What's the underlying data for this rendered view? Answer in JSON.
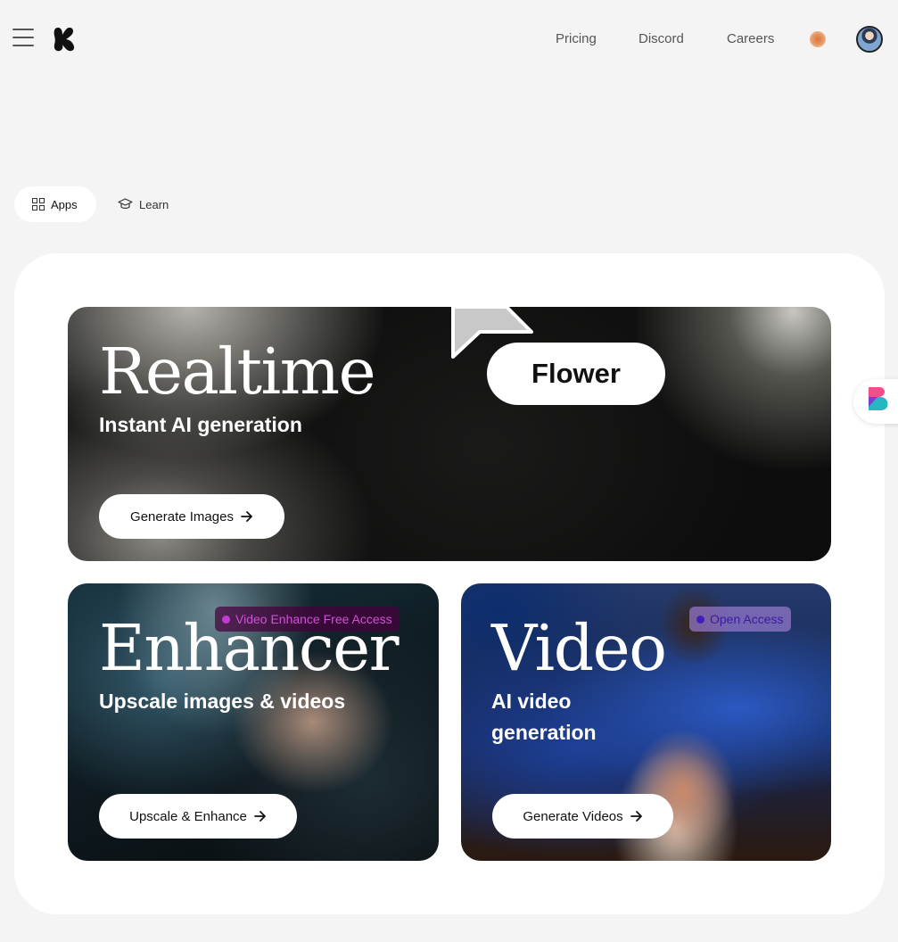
{
  "header": {
    "nav": [
      "Pricing",
      "Discord",
      "Careers"
    ]
  },
  "tabs": [
    {
      "label": "Apps",
      "active": true,
      "icon": "grid-icon"
    },
    {
      "label": "Learn",
      "active": false,
      "icon": "graduation-cap-icon"
    }
  ],
  "cards": {
    "realtime": {
      "title": "Realtime",
      "subtitle": "Instant AI generation",
      "cta": "Generate Images",
      "demo_prompt": "Flower"
    },
    "enhancer": {
      "title": "Enhancer",
      "subtitle": "Upscale images & videos",
      "cta": "Upscale & Enhance",
      "badge": "Video Enhance Free Access"
    },
    "video": {
      "title": "Video",
      "subtitle_line1": "AI video",
      "subtitle_line2": "generation",
      "cta": "Generate Videos",
      "badge": "Open Access"
    }
  },
  "colors": {
    "page_bg": "#f4f4f4",
    "panel_bg": "#ffffff",
    "badge_enhance_text": "#d050d8",
    "badge_open_text": "#3a1ca0"
  }
}
